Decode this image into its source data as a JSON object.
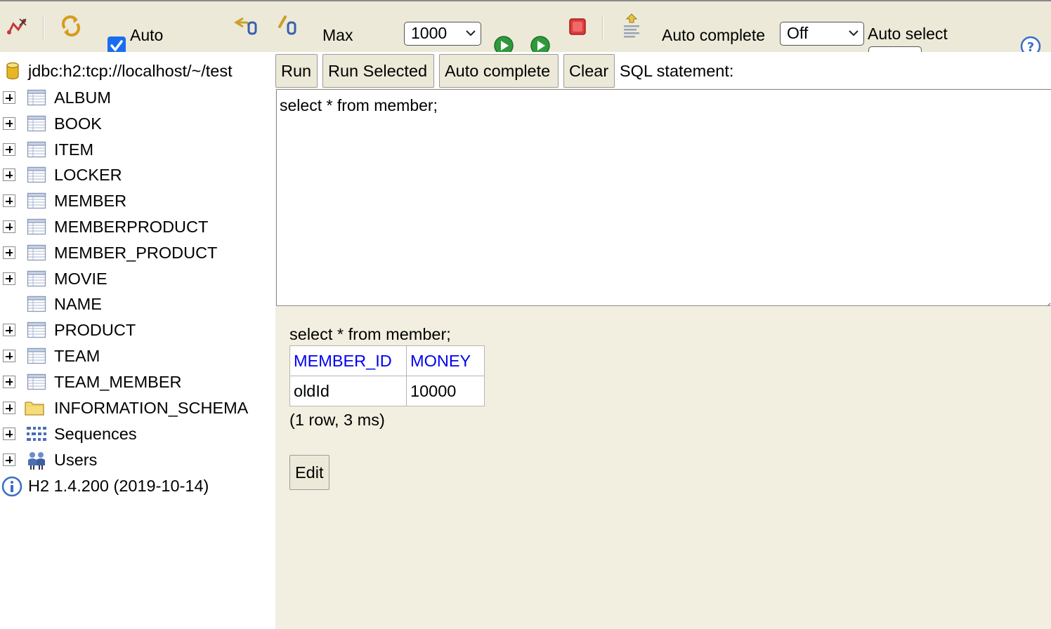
{
  "toolbar": {
    "auto_commit_label": "Auto",
    "auto_commit_checked": true,
    "max_label": "Max",
    "max_rows_value": "1000",
    "auto_complete_label": "Auto complete",
    "auto_complete_value": "Off",
    "auto_select_label": "Auto select",
    "icons": [
      "disconnect-icon",
      "refresh-icon",
      "rollback-icon",
      "commit-icon",
      "run-icon",
      "run-selected-icon",
      "stop-icon",
      "history-icon",
      "help-icon"
    ]
  },
  "tree": {
    "connection": "jdbc:h2:tcp://localhost/~/test",
    "tables": [
      "ALBUM",
      "BOOK",
      "ITEM",
      "LOCKER",
      "MEMBER",
      "MEMBERPRODUCT",
      "MEMBER_PRODUCT",
      "MOVIE",
      "NAME",
      "PRODUCT",
      "TEAM",
      "TEAM_MEMBER"
    ],
    "schema": "INFORMATION_SCHEMA",
    "sequences": "Sequences",
    "users": "Users",
    "version": "H2 1.4.200 (2019-10-14)"
  },
  "query": {
    "buttons": {
      "run": "Run",
      "run_selected": "Run Selected",
      "auto_complete": "Auto complete",
      "clear": "Clear"
    },
    "sql_label": "SQL statement:",
    "editor_text": "select * from member;",
    "result": {
      "statement": "select * from member;",
      "columns": [
        "MEMBER_ID",
        "MONEY"
      ],
      "rows": [
        [
          "oldId",
          "10000"
        ]
      ],
      "info": "(1 row, 3 ms)",
      "edit_label": "Edit"
    }
  },
  "colors": {
    "toolbar_bg": "#ece9d8",
    "panel_bg": "#f2efe1",
    "column_header": "#0000ee",
    "run_green": "#2f9a3c",
    "stop_red": "#e03a3a",
    "check_blue": "#1a6df0"
  }
}
